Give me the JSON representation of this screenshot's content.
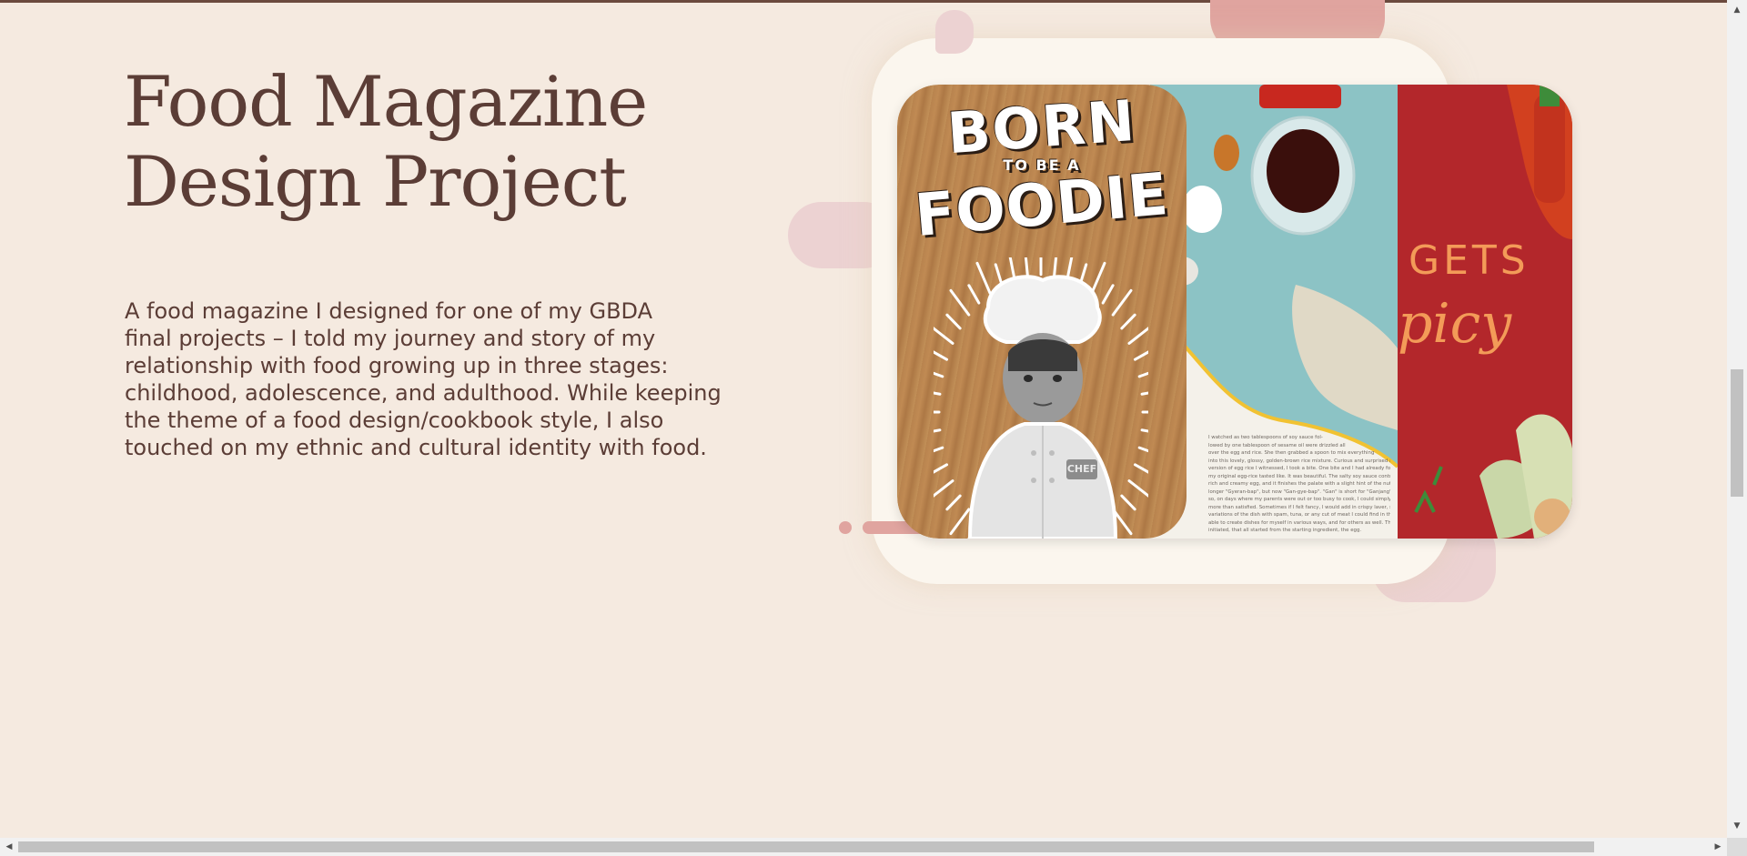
{
  "project": {
    "title_line1": "Food Magazine",
    "title_line2": "Design Project",
    "description_lines": [
      "A food magazine I designed for one of my GBDA",
      "final projects – I told my journey and story of my",
      "relationship with food growing up in three stages:",
      "childhood, adolescence, and adulthood. While keeping",
      "the theme of a food design/cookbook style, I also",
      "touched on my ethnic and cultural identity with food."
    ]
  },
  "gallery": {
    "cover": {
      "line1": "BORN",
      "line2": "TO BE A",
      "line3": "FOODIE",
      "tag": "CHEF"
    },
    "spread_text_lines": [
      "I watched as two tablespoons of soy sauce fol-",
      "lowed by one tablespoon of sesame oil were drizzled all",
      "over the egg and rice. She then grabbed a spoon to mix everything",
      "into this lovely, glossy, golden-brown rice mixture. Curious and surprised at this",
      "version of egg rice I witnessed, I took a bite. One bite and I had already forgotten",
      "my original egg-rice tasted like. It was beautiful. The salty soy sauce contrasted the",
      "rich and creamy egg, and it finishes the palate with a slight hint of the nutty sesame.",
      "longer \"Gyeran-bap\", but now \"Gan-gye-bap\". \"Gan\" is short for \"Ganjang\", which",
      "so, on days where my parents were out or too busy to cook, I could simply make",
      "more than satisfied. Sometimes if I felt fancy, I would add in crispy laver, some",
      "variations of the dish with spam, tuna, or any cut of meat I could find in the",
      "able to create dishes for myself in various ways, and for others as well. This",
      "initiated, that all started from the starting ingredient, the egg."
    ],
    "red_word1": "GETS",
    "red_word2": "picy"
  },
  "colors": {
    "background": "#f5eae0",
    "text": "#5b3d36",
    "accent_pink": "#e0a49f",
    "accent_light_pink": "#ecd2d2",
    "card_frame": "#fbf6ee"
  },
  "icons": {
    "scroll_up": "▲",
    "scroll_down": "▼",
    "scroll_left": "◀",
    "scroll_right": "▶"
  }
}
